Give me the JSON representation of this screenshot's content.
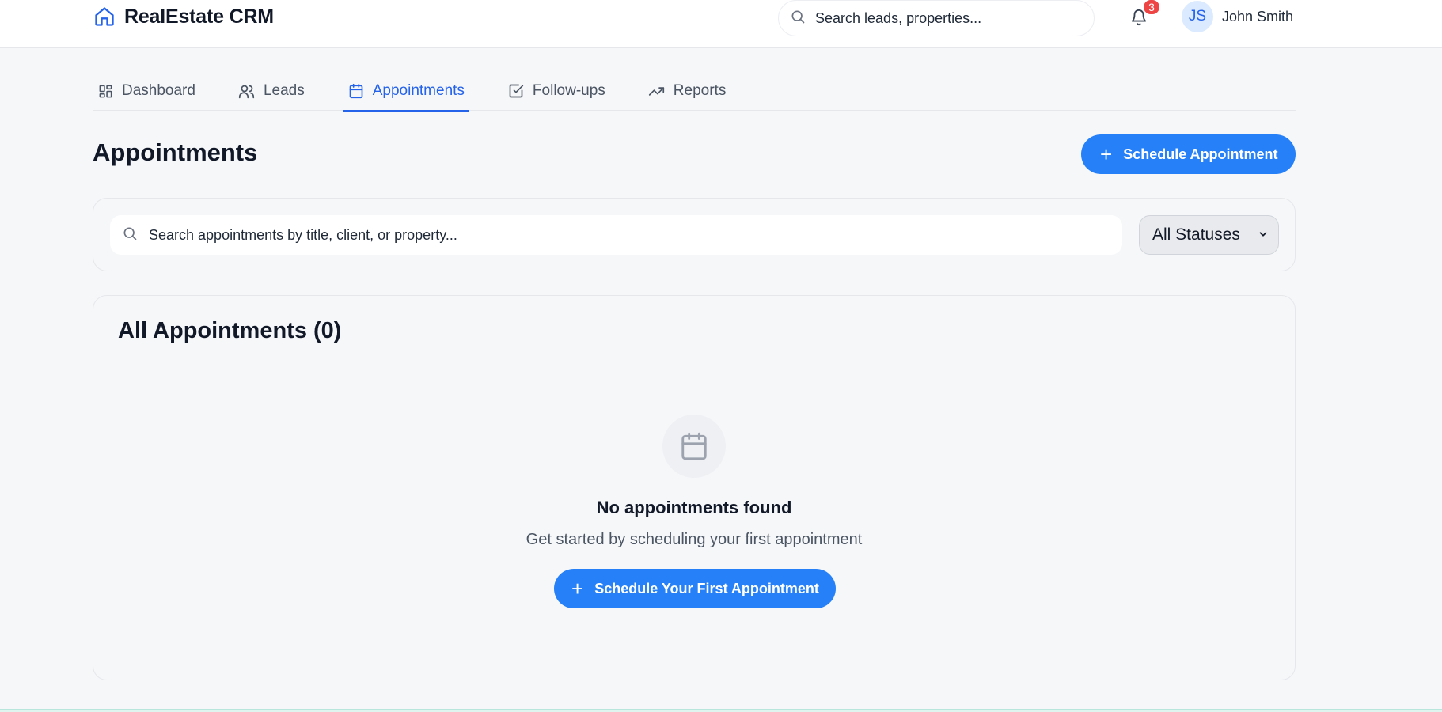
{
  "header": {
    "brand": "RealEstate CRM",
    "search_placeholder": "Search leads, properties...",
    "notification_count": "3",
    "user_initials": "JS",
    "user_name": "John Smith"
  },
  "tabs": [
    {
      "label": "Dashboard",
      "icon": "dashboard-icon",
      "active": false
    },
    {
      "label": "Leads",
      "icon": "users-icon",
      "active": false
    },
    {
      "label": "Appointments",
      "icon": "calendar-icon",
      "active": true
    },
    {
      "label": "Follow-ups",
      "icon": "check-square-icon",
      "active": false
    },
    {
      "label": "Reports",
      "icon": "trending-up-icon",
      "active": false
    }
  ],
  "page": {
    "title": "Appointments",
    "schedule_button": "Schedule Appointment"
  },
  "filters": {
    "search_placeholder": "Search appointments by title, client, or property...",
    "status_selected": "All Statuses"
  },
  "list": {
    "title": "All Appointments (0)",
    "empty_title": "No appointments found",
    "empty_subtitle": "Get started by scheduling your first appointment",
    "empty_button": "Schedule Your First Appointment"
  },
  "colors": {
    "accent": "#2563eb",
    "button": "#2680f8",
    "badge": "#ef4444"
  }
}
